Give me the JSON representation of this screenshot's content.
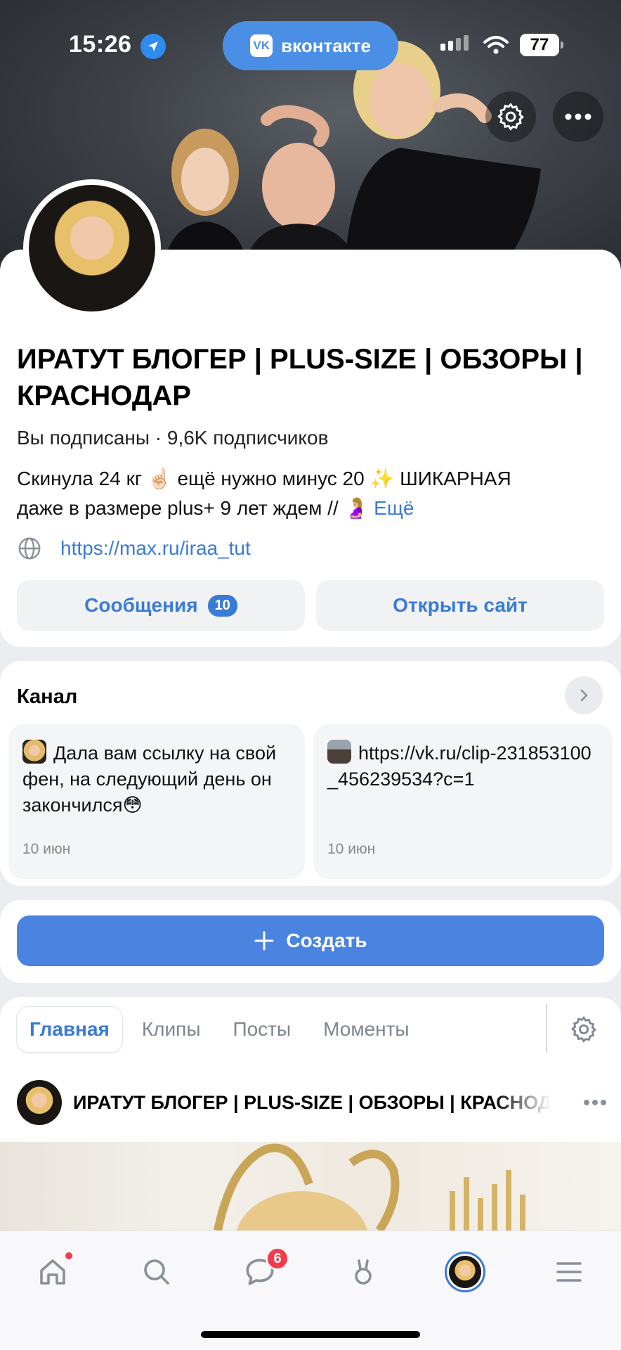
{
  "status_bar": {
    "time": "15:26",
    "battery": "77"
  },
  "header": {
    "app_pill": "вконтакте",
    "app_logo": "VK"
  },
  "profile": {
    "title": "ИРАТУТ БЛОГЕР | PLUS-SIZE | ОБЗОРЫ | КРАСНОДАР",
    "subscription": "Вы подписаны · 9,6K подписчиков",
    "bio_line1": "Скинула 24 кг ☝🏻 ещё нужно минус 20 ✨      ШИКАРНАЯ",
    "bio_line2": "даже в размере plus+   9 лет ждем // 🤰🏼 ",
    "bio_more": "Ещё",
    "link": "https://max.ru/iraa_tut"
  },
  "actions": {
    "messages_label": "Сообщения",
    "messages_count": "10",
    "open_site_label": "Открыть сайт"
  },
  "channel": {
    "title": "Канал",
    "posts": [
      {
        "text": "Дала вам ссылку на свой фен, на следующий день он закончился😳",
        "date": "10 июн"
      },
      {
        "text": "https://vk.ru/clip-231853100_456239534?c=1",
        "date": "10 июн"
      }
    ]
  },
  "create": {
    "label": "Создать"
  },
  "tabs": [
    "Главная",
    "Клипы",
    "Посты",
    "Моменты"
  ],
  "feed": {
    "author": "ИРАТУТ БЛОГЕР | PLUS-SIZE | ОБЗОРЫ | КРАСНОДАР"
  },
  "bottom_nav": {
    "messages_badge": "6"
  },
  "colors": {
    "accent": "#3a7bd5",
    "pill": "#4a8fe5",
    "create": "#4a84e0",
    "badge_red": "#f23c4e"
  }
}
